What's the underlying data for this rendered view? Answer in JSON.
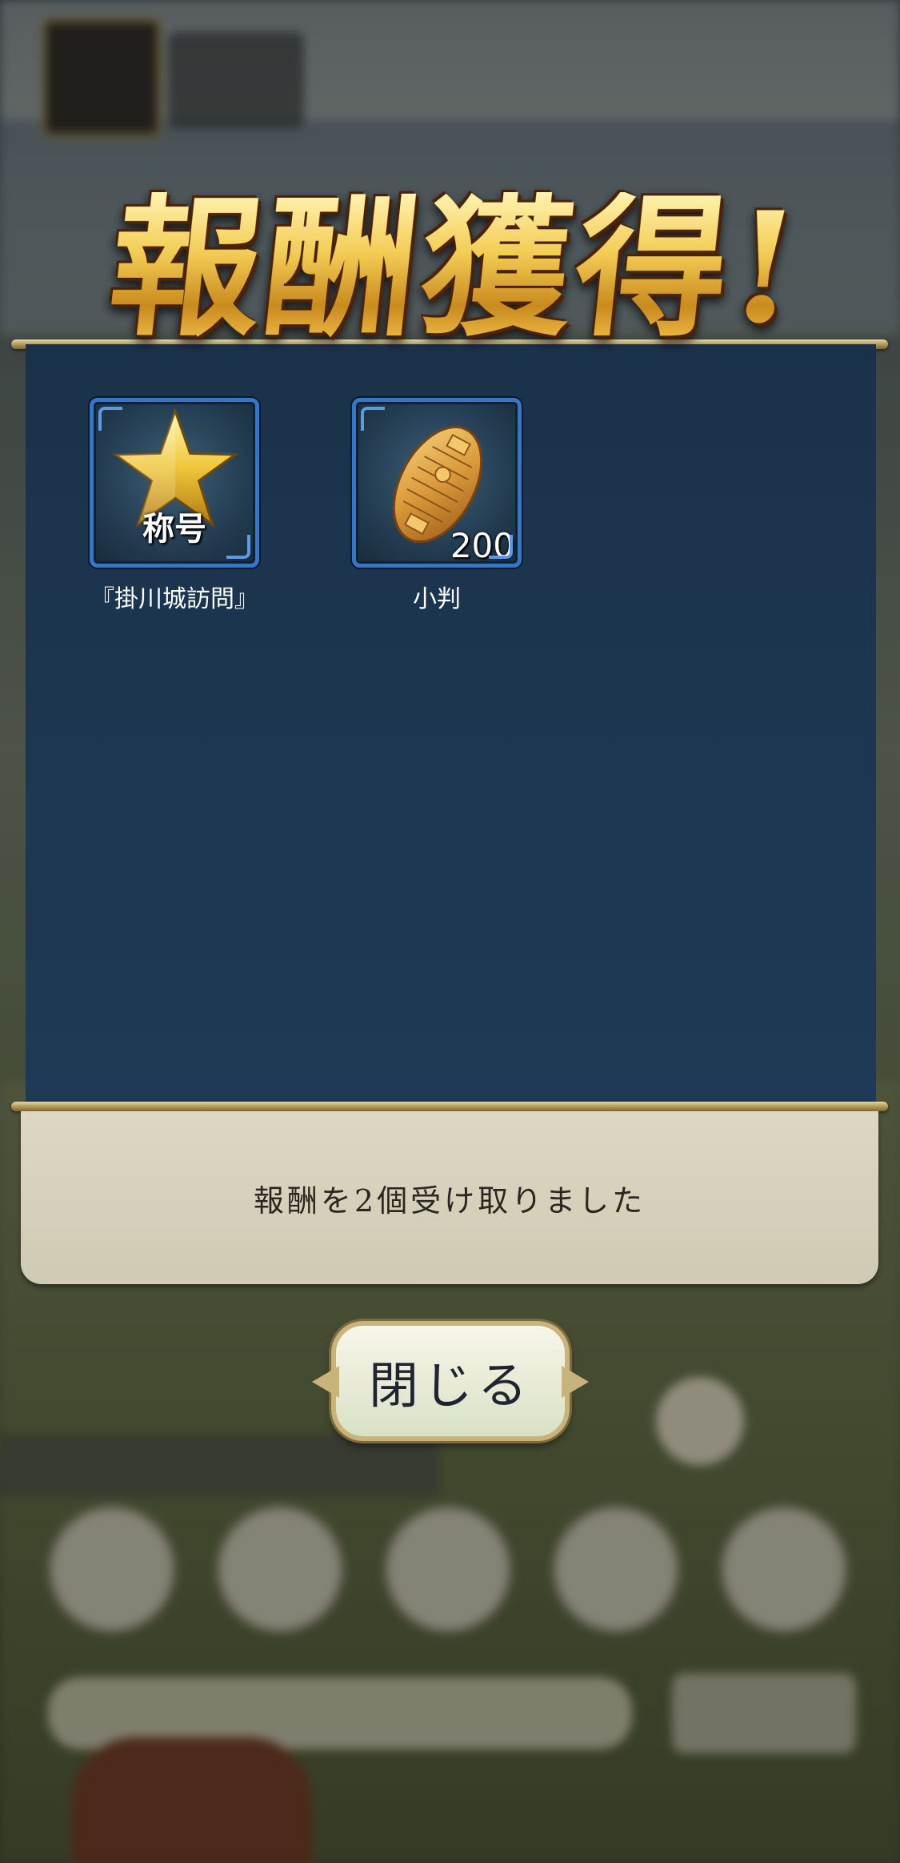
{
  "header": {
    "title": "報酬獲得!"
  },
  "rewards": [
    {
      "icon": "star-icon",
      "badge": "称号",
      "label": "『掛川城訪問』"
    },
    {
      "icon": "koban-icon",
      "quantity": "200",
      "label": "小判"
    }
  ],
  "message": "報酬を2個受け取りました",
  "close_button": {
    "label": "閉じる"
  },
  "colors": {
    "panel": "#1d3650",
    "title_gold": "#f3cc55",
    "frame_border": "#3a74c6",
    "message_box": "#d6d2bc"
  }
}
